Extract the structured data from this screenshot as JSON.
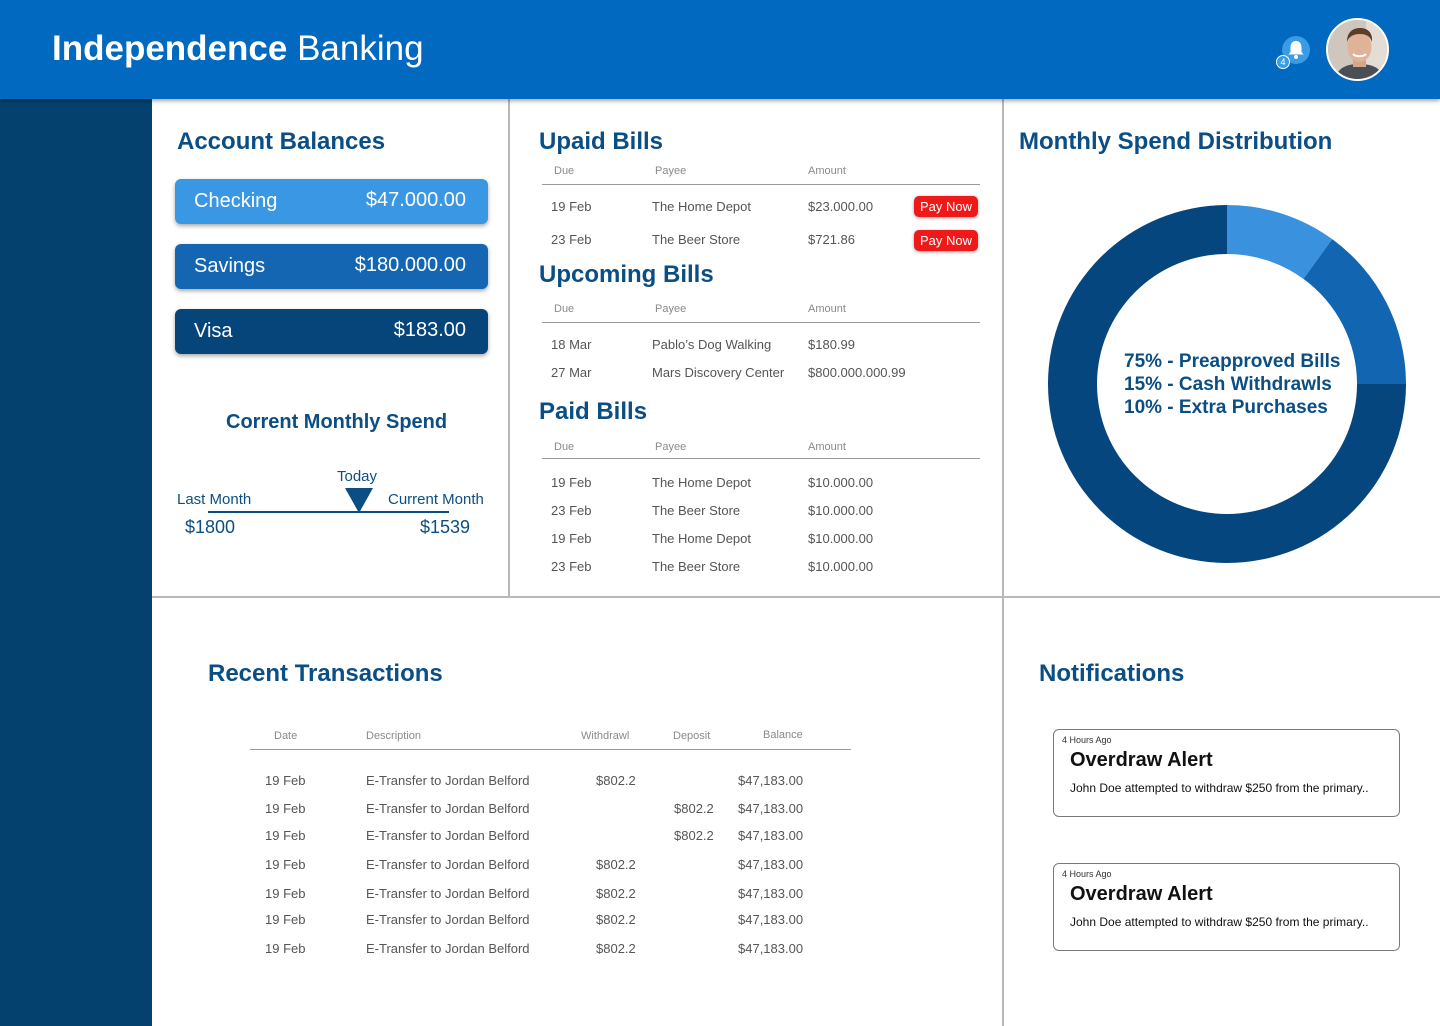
{
  "header": {
    "brand_bold": "Independence",
    "brand_light": "Banking",
    "notification_count": "4"
  },
  "accounts": {
    "title": "Account Balances",
    "items": [
      {
        "name": "Checking",
        "amount": "$47.000.00",
        "color": "#3a97e3"
      },
      {
        "name": "Savings",
        "amount": "$180.000.00",
        "color": "#1466b3"
      },
      {
        "name": "Visa",
        "amount": "$183.00",
        "color": "#06457a"
      }
    ]
  },
  "spend": {
    "title": "Corrent Monthly Spend",
    "today_label": "Today",
    "last_label": "Last Month",
    "current_label": "Current Month",
    "last_value": "$1800",
    "current_value": "$1539"
  },
  "unpaid": {
    "title": "Upaid Bills",
    "headers": [
      "Due",
      "Payee",
      "Amount"
    ],
    "pay_label": "Pay Now",
    "rows": [
      {
        "due": "19 Feb",
        "payee": "The Home Depot",
        "amount": "$23.000.00"
      },
      {
        "due": "23 Feb",
        "payee": "The Beer Store",
        "amount": "$721.86"
      }
    ]
  },
  "upcoming": {
    "title": "Upcoming Bills",
    "headers": [
      "Due",
      "Payee",
      "Amount"
    ],
    "rows": [
      {
        "due": "18 Mar",
        "payee": "Pablo’s Dog Walking",
        "amount": "$180.99"
      },
      {
        "due": "27 Mar",
        "payee": "Mars Discovery Center",
        "amount": "$800.000.000.99"
      }
    ]
  },
  "paid": {
    "title": "Paid Bills",
    "headers": [
      "Due",
      "Payee",
      "Amount"
    ],
    "rows": [
      {
        "due": "19 Feb",
        "payee": "The Home Depot",
        "amount": "$10.000.00"
      },
      {
        "due": "23 Feb",
        "payee": "The Beer Store",
        "amount": "$10.000.00"
      },
      {
        "due": "19 Feb",
        "payee": "The Home Depot",
        "amount": "$10.000.00"
      },
      {
        "due": "23 Feb",
        "payee": "The Beer Store",
        "amount": "$10.000.00"
      }
    ]
  },
  "distribution": {
    "title": "Monthly Spend Distribution",
    "labels": [
      "75% - Preapproved Bills",
      "15% - Cash Withdrawls",
      "10% - Extra Purchases"
    ]
  },
  "chart_data": {
    "type": "pie",
    "categories": [
      "Preapproved Bills",
      "Cash Withdrawls",
      "Extra Purchases"
    ],
    "values": [
      75,
      15,
      10
    ],
    "colors": [
      "#05467e",
      "#1266b1",
      "#3a92df"
    ],
    "title": "Monthly Spend Distribution",
    "donut": true
  },
  "transactions": {
    "title": "Recent Transactions",
    "headers": [
      "Date",
      "Description",
      "Withdrawl",
      "Deposit",
      "Balance"
    ],
    "rows": [
      {
        "date": "19 Feb",
        "desc": "E-Transfer to Jordan Belford",
        "withdrawl": "$802.2",
        "deposit": "",
        "balance": "$47,183.00"
      },
      {
        "date": "19 Feb",
        "desc": "E-Transfer to Jordan Belford",
        "withdrawl": "",
        "deposit": "$802.2",
        "balance": "$47,183.00"
      },
      {
        "date": "19 Feb",
        "desc": "E-Transfer to Jordan Belford",
        "withdrawl": "",
        "deposit": "$802.2",
        "balance": "$47,183.00"
      },
      {
        "date": "19 Feb",
        "desc": "E-Transfer to Jordan Belford",
        "withdrawl": "$802.2",
        "deposit": "",
        "balance": "$47,183.00"
      },
      {
        "date": "19 Feb",
        "desc": "E-Transfer to Jordan Belford",
        "withdrawl": "$802.2",
        "deposit": "",
        "balance": "$47,183.00"
      },
      {
        "date": "19 Feb",
        "desc": "E-Transfer to Jordan Belford",
        "withdrawl": "$802.2",
        "deposit": "",
        "balance": "$47,183.00"
      },
      {
        "date": "19 Feb",
        "desc": "E-Transfer to Jordan Belford",
        "withdrawl": "$802.2",
        "deposit": "",
        "balance": "$47,183.00"
      }
    ]
  },
  "notifications": {
    "title": "Notifications",
    "items": [
      {
        "time": "4 Hours Ago",
        "heading": "Overdraw Alert",
        "body": "John Doe attempted to withdraw $250 from the primary.."
      },
      {
        "time": "4 Hours Ago",
        "heading": "Overdraw Alert",
        "body": "John Doe attempted to withdraw $250 from the primary.."
      }
    ]
  }
}
